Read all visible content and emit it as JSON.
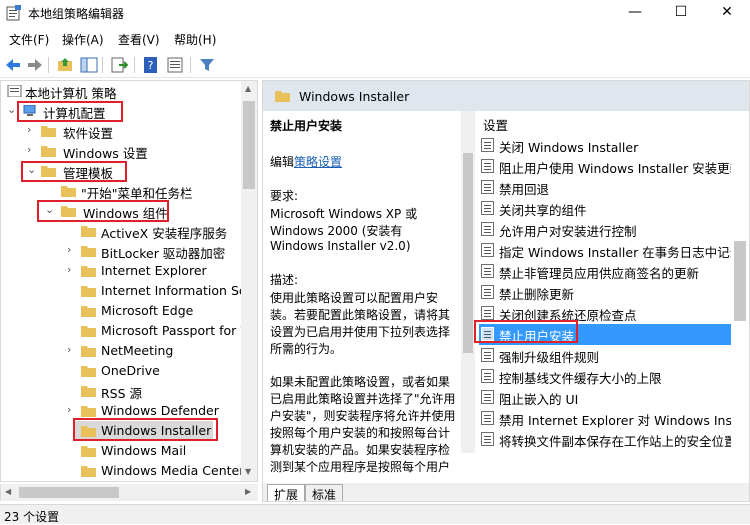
{
  "window": {
    "title": "本地组策略编辑器",
    "minimize": "—",
    "maximize": "☐",
    "close": "✕"
  },
  "menu": [
    "文件(F)",
    "操作(A)",
    "查看(V)",
    "帮助(H)"
  ],
  "tree": {
    "items": [
      {
        "label": "本地计算机 策略",
        "expanded": true,
        "level": 0
      },
      {
        "label": "计算机配置",
        "expanded": true,
        "level": 0,
        "highlighted": true
      },
      {
        "label": "软件设置",
        "level": 1
      },
      {
        "label": "Windows 设置",
        "level": 1
      },
      {
        "label": "管理模板",
        "expanded": true,
        "level": 1,
        "highlighted": true
      },
      {
        "label": "\"开始\"菜单和任务栏",
        "level": 2
      },
      {
        "label": "Windows 组件",
        "expanded": true,
        "level": 2,
        "highlighted": true
      },
      {
        "label": "ActiveX 安装程序服务",
        "level": 3
      },
      {
        "label": "BitLocker 驱动器加密",
        "level": 3
      },
      {
        "label": "Internet Explorer",
        "level": 3
      },
      {
        "label": "Internet Information Ser",
        "level": 3
      },
      {
        "label": "Microsoft Edge",
        "level": 3
      },
      {
        "label": "Microsoft Passport for W",
        "level": 3
      },
      {
        "label": "NetMeeting",
        "level": 3
      },
      {
        "label": "OneDrive",
        "level": 3
      },
      {
        "label": "RSS 源",
        "level": 3
      },
      {
        "label": "Windows Defender",
        "level": 3
      },
      {
        "label": "Windows Installer",
        "level": 3,
        "selected": true,
        "highlighted": true
      },
      {
        "label": "Windows Mail",
        "level": 3
      },
      {
        "label": "Windows Media Center",
        "level": 3
      }
    ]
  },
  "right": {
    "header": "Windows Installer",
    "description": {
      "title": "禁止用户安装",
      "edit_prefix": "编辑",
      "edit_link": "策略设置",
      "requirements_label": "要求:",
      "requirements": [
        "Microsoft Windows XP 或",
        "Windows 2000 (安装有",
        "Windows Installer v2.0)"
      ],
      "desc_label": "描述:",
      "desc_lines": [
        "使用此策略设置可以配置用户安",
        "装。若要配置此策略设置，请将其",
        "设置为已启用并使用下拉列表选择",
        "所需的行为。"
      ],
      "more_lines": [
        "如果未配置此策略设置，或者如果",
        "已启用此策略设置并选择了\"允许用",
        "户安装\"，则安装程序将允许并使用",
        "按照每个用户安装的和按照每台计",
        "算机安装的产品。如果安装程序检",
        "测到某个应用程序是按照每个用户"
      ]
    },
    "list_header": "设置",
    "settings": [
      "关闭 Windows Installer",
      "阻止用户使用 Windows Installer 安装更新和",
      "禁用回退",
      "关闭共享的组件",
      "允许用户对安装进行控制",
      "指定 Windows Installer 在事务日志中记录的",
      "禁止非管理员应用供应商签名的更新",
      "禁止删除更新",
      "关闭创建系统还原检查点",
      "禁止用户安装",
      "强制升级组件规则",
      "控制基线文件缓存大小的上限",
      "阻止嵌入的 UI",
      "禁用 Internet Explorer 对 Windows Instal",
      "将转换文件副本保存在工作站上的安全位置"
    ],
    "selected_index": 9,
    "tabs": [
      "扩展",
      "标准"
    ]
  },
  "status": "23 个设置",
  "colors": {
    "highlight": "#e0202a",
    "selection": "#3399ff",
    "header_bg": "#dfe6ee"
  }
}
